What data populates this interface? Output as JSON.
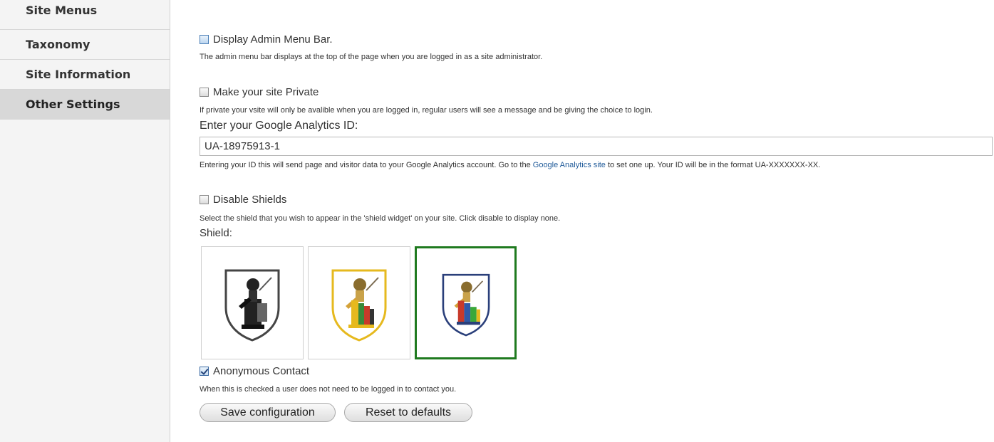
{
  "sidebar": {
    "items": [
      {
        "label": "Site Menus"
      },
      {
        "label": "Taxonomy"
      },
      {
        "label": "Site Information"
      },
      {
        "label": "Other Settings"
      }
    ]
  },
  "admin_menu": {
    "label": "Display Admin Menu Bar.",
    "description": "The admin menu bar displays at the top of the page when you are logged in as a site administrator."
  },
  "private": {
    "label": "Make your site Private",
    "description": "If private your vsite will only be avalible when you are logged in, regular users will see a message and be giving the choice to login."
  },
  "analytics": {
    "label": "Enter your Google Analytics ID:",
    "value": "UA-18975913-1",
    "desc_before": "Entering your ID this will send page and visitor data to your Google Analytics account. Go to the ",
    "link_text": "Google Analytics site",
    "desc_after": " to set one up. Your ID will be in the format UA-XXXXXXX-XX."
  },
  "shields": {
    "disable_label": "Disable Shields",
    "description": "Select the shield that you wish to appear in the 'shield widget' on your site. Click disable to display none.",
    "label": "Shield:",
    "options": [
      {
        "icon": "shield-black-white-icon",
        "selected": false
      },
      {
        "icon": "shield-gold-icon",
        "selected": false
      },
      {
        "icon": "shield-blue-color-icon",
        "selected": true
      }
    ]
  },
  "anonymous_contact": {
    "label": "Anonymous Contact",
    "checked": true,
    "description": "When this is checked a user does not need to be logged in to contact you."
  },
  "buttons": {
    "save": "Save configuration",
    "reset": "Reset to defaults"
  },
  "colors": {
    "selected_border": "#1f7a1f",
    "link": "#1f5a99"
  }
}
